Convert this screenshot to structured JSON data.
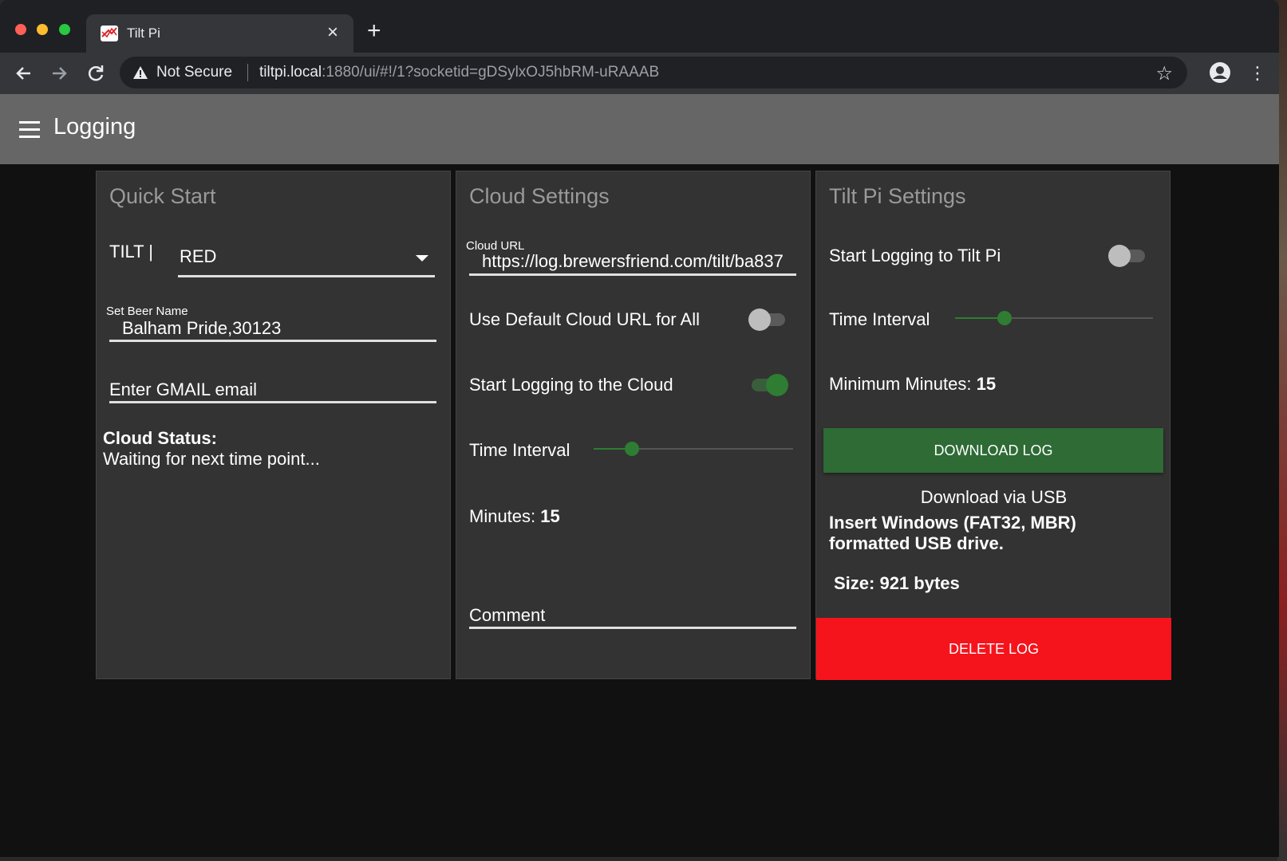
{
  "browser": {
    "tab_title": "Tilt Pi",
    "tab_close": "×",
    "new_tab": "+",
    "security_label": "Not Secure",
    "url_host": "tiltpi.local",
    "url_rest": ":1880/ui/#!/1?socketid=gDSylxOJ5hbRM-uRAAAB"
  },
  "app": {
    "title": "Logging"
  },
  "quick_start": {
    "title": "Quick Start",
    "tilt_label": "TILT |",
    "tilt_value": "RED",
    "beer_name_label": "Set Beer Name",
    "beer_name_value": "Balham Pride,30123",
    "email_placeholder": "Enter GMAIL email",
    "cloud_status_label": "Cloud Status:",
    "cloud_status_value": "Waiting for next time point..."
  },
  "cloud_settings": {
    "title": "Cloud Settings",
    "cloud_url_label": "Cloud URL",
    "cloud_url_value": "https://log.brewersfriend.com/tilt/ba837",
    "default_url_label": "Use Default Cloud URL for All",
    "default_url_on": false,
    "start_logging_label": "Start Logging to the Cloud",
    "start_logging_on": true,
    "time_interval_label": "Time Interval",
    "time_interval_fraction": 0.19,
    "minutes_label": "Minutes:",
    "minutes_value": "15",
    "comment_placeholder": "Comment"
  },
  "tiltpi_settings": {
    "title": "Tilt Pi Settings",
    "start_logging_label": "Start Logging to Tilt Pi",
    "start_logging_on": false,
    "time_interval_label": "Time Interval",
    "time_interval_fraction": 0.25,
    "min_minutes_label": "Minimum Minutes:",
    "min_minutes_value": "15",
    "download_button": "DOWNLOAD LOG",
    "usb_title": "Download via USB",
    "usb_instructions": "Insert Windows (FAT32, MBR) formatted USB drive.",
    "size_label": "Size: 921 bytes",
    "delete_button": "DELETE LOG"
  },
  "colors": {
    "accent_green": "#2e7d32",
    "delete_red": "#f5141c",
    "header_gray": "#666666"
  }
}
